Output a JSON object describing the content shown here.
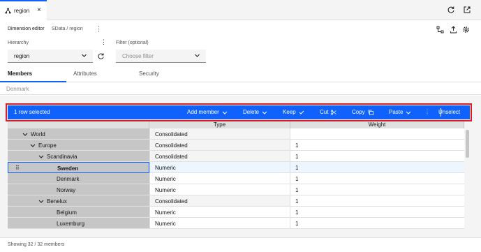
{
  "tab": {
    "label": "region",
    "icon": "dimension-icon"
  },
  "top_icons": [
    "refresh-icon",
    "popout-icon"
  ],
  "editor": {
    "title": "Dimension editor",
    "path": "SData / region"
  },
  "right_icons": [
    "hierarchy-icon",
    "upload-icon",
    "settings-icon"
  ],
  "hierarchy": {
    "label": "Hierarchy",
    "value": "region"
  },
  "filter": {
    "label": "Filter (optional)",
    "placeholder": "Choose filter"
  },
  "subtabs": [
    {
      "label": "Members",
      "active": true
    },
    {
      "label": "Attributes",
      "active": false
    },
    {
      "label": "Security",
      "active": false
    }
  ],
  "search": {
    "value": "Denmark"
  },
  "toolbar": {
    "status": "1 row selected",
    "add_member": "Add member",
    "delete": "Delete",
    "keep": "Keep",
    "cut": "Cut",
    "copy": "Copy",
    "paste": "Paste",
    "unselect": "Unselect"
  },
  "columns": {
    "type": "Type",
    "weight": "Weight"
  },
  "rows": [
    {
      "name": "World",
      "type": "Consolidated",
      "weight": "",
      "expandable": true,
      "selected": false
    },
    {
      "name": "Europe",
      "type": "Consolidated",
      "weight": "1",
      "expandable": true,
      "selected": false
    },
    {
      "name": "Scandinavia",
      "type": "Consolidated",
      "weight": "1",
      "expandable": true,
      "selected": false
    },
    {
      "name": "Sweden",
      "type": "Numeric",
      "weight": "1",
      "expandable": false,
      "selected": true
    },
    {
      "name": "Denmark",
      "type": "Numeric",
      "weight": "1",
      "expandable": false,
      "selected": false
    },
    {
      "name": "Norway",
      "type": "Numeric",
      "weight": "1",
      "expandable": false,
      "selected": false
    },
    {
      "name": "Benelux",
      "type": "Consolidated",
      "weight": "1",
      "expandable": true,
      "selected": false
    },
    {
      "name": "Belgium",
      "type": "Numeric",
      "weight": "1",
      "expandable": false,
      "selected": false
    },
    {
      "name": "Luxemburg",
      "type": "Numeric",
      "weight": "1",
      "expandable": false,
      "selected": false
    }
  ],
  "footer": {
    "text": "Showing 32 / 32 members"
  },
  "colors": {
    "accent": "#0f62fe",
    "highlight_outline": "#da1e28"
  }
}
